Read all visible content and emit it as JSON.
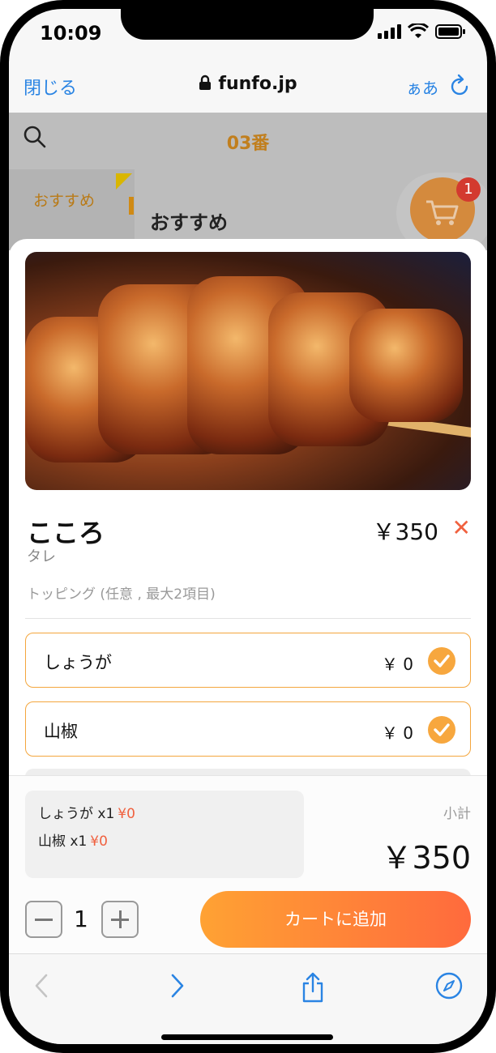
{
  "status_bar": {
    "time": "10:09"
  },
  "browser": {
    "close_label": "閉じる",
    "url": "funfo.jp",
    "text_size_label": "ぁあ"
  },
  "background_page": {
    "table_label": "03番",
    "sidebar_item": "おすすめ",
    "section_heading": "おすすめ",
    "cart_badge": "1"
  },
  "item": {
    "name": "こころ",
    "subtitle": "タレ",
    "price": "￥350",
    "topping_header": "トッピング (任意 , 最大2項目)"
  },
  "options": [
    {
      "label": "しょうが",
      "price": "￥ 0",
      "selected": true
    },
    {
      "label": "山椒",
      "price": "￥ 0",
      "selected": true
    }
  ],
  "summary": {
    "lines": [
      {
        "text": "しょうが x1",
        "price": "¥0"
      },
      {
        "text": "山椒 x1",
        "price": "¥0"
      }
    ],
    "subtotal_label": "小計",
    "subtotal": "￥350"
  },
  "quantity": {
    "value": "1"
  },
  "add_to_cart_label": "カートに追加",
  "colors": {
    "accent_orange": "#f7a73e",
    "link_blue": "#2a84e3",
    "price_red": "#f0613f"
  }
}
